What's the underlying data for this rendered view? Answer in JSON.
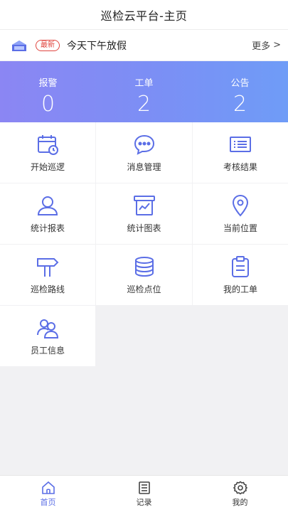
{
  "header": {
    "title": "巡检云平台-主页"
  },
  "notice": {
    "icon": "house-flag-icon",
    "badge": "最新",
    "text": "今天下午放假",
    "more": "更多",
    "more_icon": "chevron-right-icon",
    "chevron": ">"
  },
  "stats": [
    {
      "label": "报警",
      "value": "0"
    },
    {
      "label": "工单",
      "value": "2"
    },
    {
      "label": "公告",
      "value": "2"
    }
  ],
  "menu": [
    {
      "label": "开始巡逻",
      "icon": "calendar-clock-icon"
    },
    {
      "label": "消息管理",
      "icon": "chat-bubble-icon"
    },
    {
      "label": "考核结果",
      "icon": "list-card-icon"
    },
    {
      "label": "统计报表",
      "icon": "user-icon"
    },
    {
      "label": "统计图表",
      "icon": "chart-board-icon"
    },
    {
      "label": "当前位置",
      "icon": "location-pin-icon"
    },
    {
      "label": "巡检路线",
      "icon": "signpost-icon"
    },
    {
      "label": "巡检点位",
      "icon": "database-stack-icon"
    },
    {
      "label": "我的工单",
      "icon": "clipboard-icon"
    },
    {
      "label": "员工信息",
      "icon": "users-icon"
    }
  ],
  "tabs": [
    {
      "label": "首页",
      "icon": "home-icon",
      "active": true
    },
    {
      "label": "记录",
      "icon": "notebook-icon",
      "active": false
    },
    {
      "label": "我的",
      "icon": "gear-icon",
      "active": false
    }
  ],
  "colors": {
    "accent": "#5b6ee6",
    "badge_red": "#e0463f",
    "gradient_start": "#8b86f3",
    "gradient_end": "#6f9cf7"
  }
}
